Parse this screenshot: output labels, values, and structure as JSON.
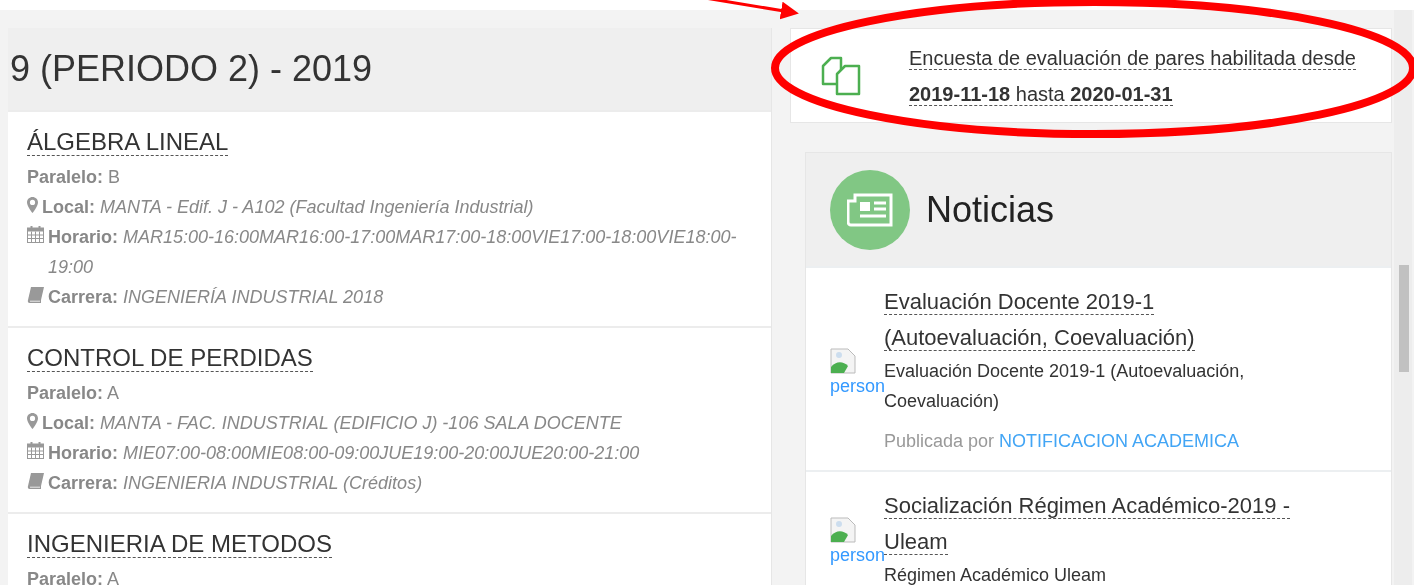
{
  "period_title": "9 (PERIODO 2) - 2019",
  "courses": [
    {
      "title": "ÁLGEBRA LINEAL",
      "fields": [
        {
          "kind": "paralelo",
          "label": "Paralelo:",
          "value": "B"
        },
        {
          "kind": "local",
          "label": "Local:",
          "value": "MANTA - Edif. J - A102 (Facultad Ingeniería Industrial)"
        },
        {
          "kind": "horario",
          "label": "Horario:",
          "value": "MAR15:00-16:00MAR16:00-17:00MAR17:00-18:00VIE17:00-18:00VIE18:00-19:00"
        },
        {
          "kind": "carrera",
          "label": "Carrera:",
          "value": "INGENIERÍA INDUSTRIAL 2018"
        }
      ]
    },
    {
      "title": "CONTROL DE PERDIDAS",
      "fields": [
        {
          "kind": "paralelo",
          "label": "Paralelo:",
          "value": "A"
        },
        {
          "kind": "local",
          "label": "Local:",
          "value": "MANTA - FAC. INDUSTRIAL (EDIFICIO J) -106 SALA DOCENTE"
        },
        {
          "kind": "horario",
          "label": "Horario:",
          "value": "MIE07:00-08:00MIE08:00-09:00JUE19:00-20:00JUE20:00-21:00"
        },
        {
          "kind": "carrera",
          "label": "Carrera:",
          "value": "INGENIERIA INDUSTRIAL (Créditos)"
        }
      ]
    },
    {
      "title": "INGENIERIA DE METODOS",
      "fields": [
        {
          "kind": "paralelo",
          "label": "Paralelo:",
          "value": "A"
        }
      ]
    }
  ],
  "survey": {
    "text": "Encuesta de evaluación de pares habilitada desde **2019-11-18** hasta **2020-01-31**"
  },
  "news": {
    "title": "Noticias",
    "items": [
      {
        "image_alt": "person",
        "title": "Evaluación Docente 2019-1 (Autoevaluación, Coevaluación)",
        "summary": "Evaluación Docente 2019-1 (Autoevaluación, Coevaluación)",
        "published_label": "Publicada por",
        "author": "NOTIFICACION ACADEMICA"
      },
      {
        "image_alt": "person",
        "title": "Socialización Régimen Académico-2019 - Uleam",
        "summary": "Régimen Académico Uleam"
      }
    ]
  }
}
